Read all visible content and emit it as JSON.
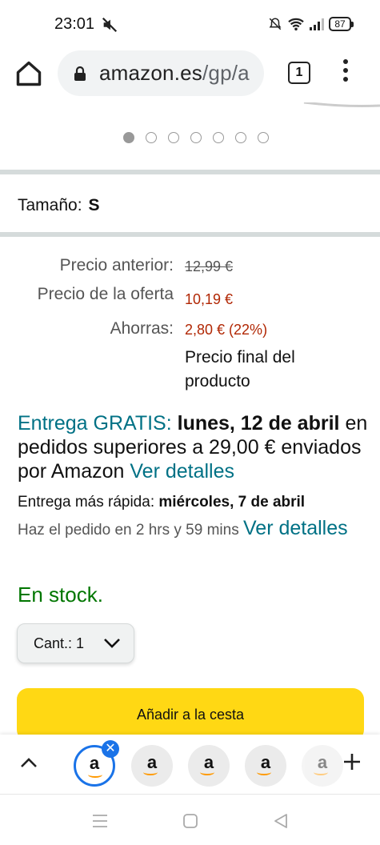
{
  "status_bar": {
    "time": "23:01",
    "battery": "87"
  },
  "browser": {
    "url_domain": "amazon.es",
    "url_path": "/gp/a",
    "tab_count": "1"
  },
  "carousel": {
    "dot_count": 7,
    "active_index": 0
  },
  "size": {
    "label": "Tamaño:",
    "value": "S"
  },
  "prices": {
    "previous_label": "Precio anterior:",
    "previous_value": "12,99 €",
    "offer_label": "Precio de la oferta",
    "offer_value": "10,19 €",
    "savings_label": "Ahorras:",
    "savings_value": "2,80 € (22%)",
    "final_note": "Precio final del producto"
  },
  "delivery": {
    "free_label": "Entrega GRATIS:",
    "date": "lunes, 12 de abril",
    "condition": "en pedidos superiores a 29,00 € enviados por Amazon",
    "details_link": "Ver detalles",
    "fast_label": "Entrega más rápida:",
    "fast_date": "miércoles, 7 de abril",
    "order_within": "Haz el pedido en 2 hrs y 59 mins",
    "order_details_link": "Ver detalles"
  },
  "stock": {
    "status": "En stock."
  },
  "quantity": {
    "label": "Cant.:",
    "value": "1"
  },
  "cart": {
    "button_label": "Añadir a la cesta"
  },
  "tab_strip": {
    "tab_letter": "a"
  },
  "colors": {
    "link": "#007185",
    "in_stock": "#007600",
    "price_red": "#b12704",
    "cart_button": "#ffd814",
    "tab_highlight": "#1a73e8"
  }
}
